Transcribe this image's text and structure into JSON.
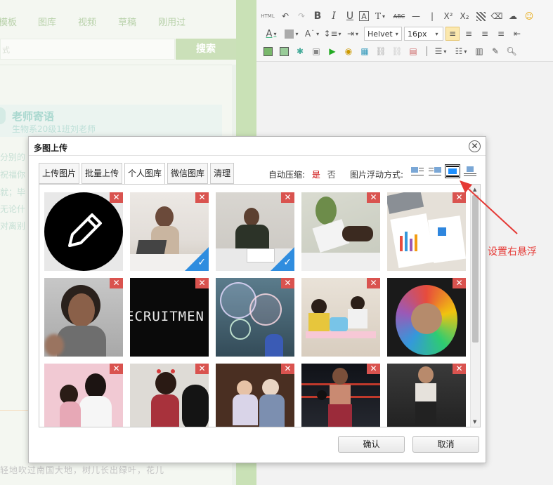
{
  "background": {
    "nav_tabs": [
      "模板",
      "图库",
      "视频",
      "草稿",
      "刚用过"
    ],
    "search_placeholder": "式",
    "search_button": "搜索",
    "teacher_title": "老师寄语",
    "teacher_subtitle": "生物系20级1班刘老师",
    "poem_lines": [
      "分别的",
      "祝福你",
      "就；毕",
      "无论什",
      "对离别"
    ],
    "bottom_text": "轻地吹过南国大地，树儿长出绿叶，花儿"
  },
  "toolbar": {
    "html_label": "HTML",
    "font_name": "Helvet",
    "font_size": "16px"
  },
  "dialog": {
    "title": "多图上传",
    "close_icon": "close-icon",
    "tabs": [
      "上传图片",
      "批量上传",
      "个人图库",
      "微信图库",
      "清理"
    ],
    "active_tab": "个人图库",
    "compress_label": "自动压缩:",
    "compress_yes": "是",
    "compress_no": "否",
    "float_label": "图片浮动方式:",
    "confirm": "确认",
    "cancel": "取消",
    "delete_mark": "✕",
    "check_mark": "✓"
  },
  "images": [
    {
      "name": "pencil-icon-image",
      "checked": false
    },
    {
      "name": "woman-office-image",
      "checked": true
    },
    {
      "name": "man-desk-image",
      "checked": true
    },
    {
      "name": "hands-tablet-image",
      "checked": false
    },
    {
      "name": "charts-paper-image",
      "checked": false
    },
    {
      "name": "girl-pointing-image",
      "checked": false
    },
    {
      "name": "recruitment-sign-image",
      "checked": false
    },
    {
      "name": "soap-bubbles-image",
      "checked": false
    },
    {
      "name": "kids-classroom-image",
      "checked": false
    },
    {
      "name": "painted-hands-image",
      "checked": false
    },
    {
      "name": "mother-child-image",
      "checked": false
    },
    {
      "name": "laughing-girl-dog-image",
      "checked": false
    },
    {
      "name": "kids-playing-image",
      "checked": false
    },
    {
      "name": "boxer-woman-image",
      "checked": false
    },
    {
      "name": "fitness-woman-image",
      "checked": false
    }
  ],
  "thumb_overlay_text": "ECRUITMEN",
  "annotation": {
    "text": "设置右悬浮",
    "color": "#e53935"
  }
}
